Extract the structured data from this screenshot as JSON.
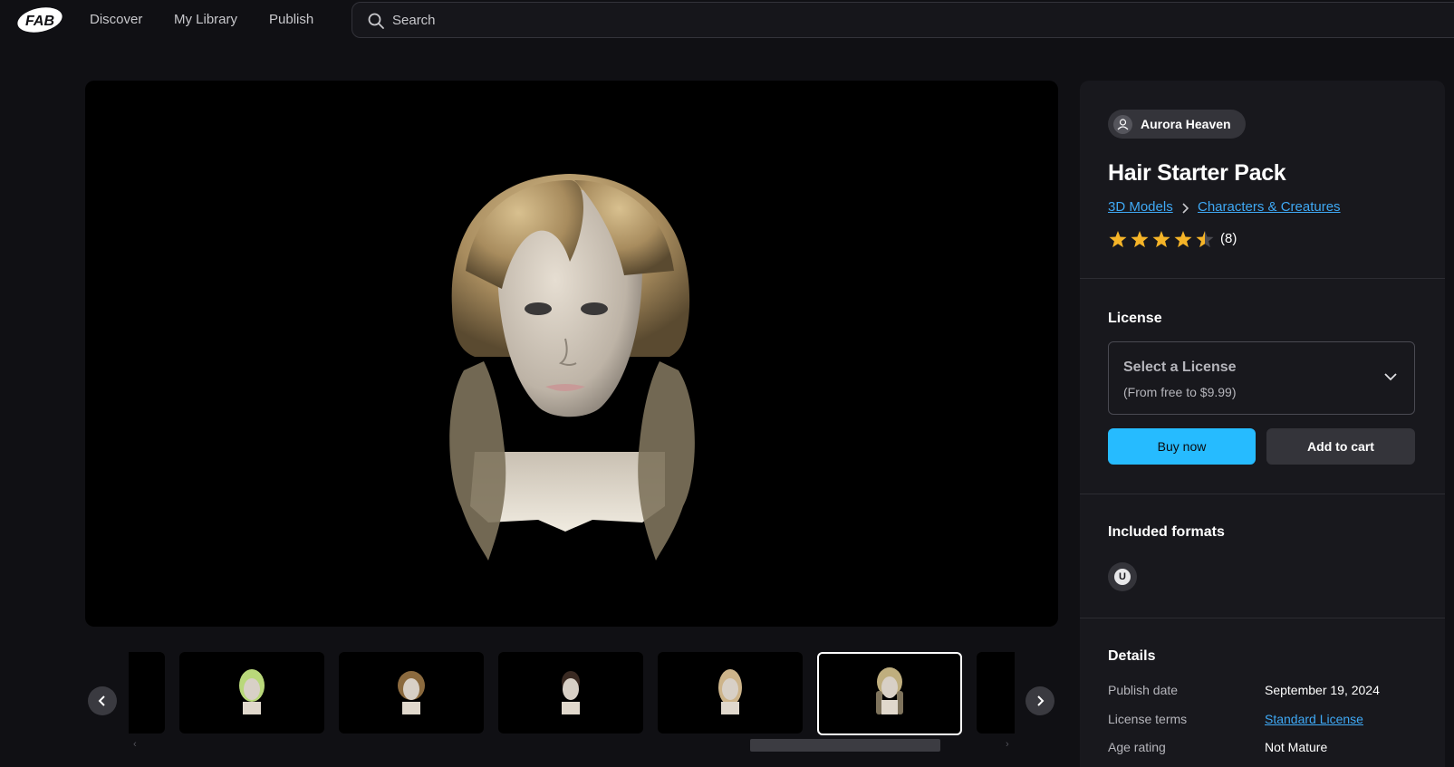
{
  "nav": {
    "logo_text": "FAB",
    "links": [
      "Discover",
      "My Library",
      "Publish"
    ],
    "search_placeholder": "Search"
  },
  "viewer": {
    "thumbnails": [
      {
        "hair_color": "#b9d87a"
      },
      {
        "hair_color": "#8b6a3e"
      },
      {
        "hair_color": "#3a2a22"
      },
      {
        "hair_color": "#cdb48a"
      },
      {
        "hair_color": "#bfae7e"
      }
    ],
    "active_thumbnail": 4
  },
  "product": {
    "author": "Aurora Heaven",
    "title": "Hair Starter Pack",
    "breadcrumb": [
      "3D Models",
      "Characters & Creatures"
    ],
    "rating": 4.5,
    "rating_count": "(8)"
  },
  "license": {
    "heading": "License",
    "select_label": "Select a License",
    "select_sub": "(From free to $9.99)",
    "buy_label": "Buy now",
    "cart_label": "Add to cart"
  },
  "formats": {
    "heading": "Included formats",
    "icons": [
      "unreal-engine-icon"
    ]
  },
  "details": {
    "heading": "Details",
    "rows": [
      {
        "label": "Publish date",
        "value": "September 19, 2024"
      },
      {
        "label": "License terms",
        "value": "Standard License"
      },
      {
        "label": "Age rating",
        "value": "Not Mature"
      }
    ]
  },
  "colors": {
    "accent": "#26bbff",
    "link": "#3fa9f5",
    "star": "#f5b428"
  }
}
